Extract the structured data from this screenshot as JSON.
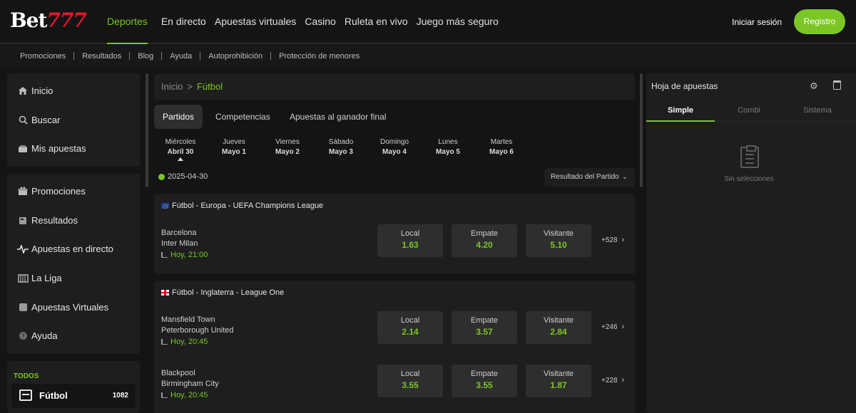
{
  "brand": {
    "logo_text": "Bet",
    "logo_num": "777",
    "accent": "#7bc624",
    "logo_red": "#e3192b"
  },
  "nav": {
    "items": [
      "Deportes",
      "En directo",
      "Apuestas virtuales",
      "Casino",
      "Ruleta en vivo",
      "Juego más seguro"
    ],
    "login": "Iniciar sesión",
    "register": "Registro"
  },
  "subnav": [
    "Promociones",
    "Resultados",
    "Blog",
    "Ayuda",
    "Autoprohibición",
    "Protección de menores"
  ],
  "sidebar": {
    "top": [
      {
        "label": "Inicio",
        "icon": "home-icon"
      },
      {
        "label": "Buscar",
        "icon": "search-icon"
      },
      {
        "label": "Mis apuestas",
        "icon": "wallet-icon"
      }
    ],
    "links": [
      {
        "label": "Promociones",
        "icon": "gift-icon"
      },
      {
        "label": "Resultados",
        "icon": "results-icon"
      },
      {
        "label": "Apuestas en directo",
        "icon": "pulse-icon"
      },
      {
        "label": "La Liga",
        "icon": "league-icon"
      },
      {
        "label": "Apuestas Virtuales",
        "icon": "virtual-icon"
      },
      {
        "label": "Ayuda",
        "icon": "help-icon"
      }
    ],
    "section_title": "TODOS",
    "sport": {
      "label": "Fútbol",
      "count": "1082"
    }
  },
  "breadcrumb": {
    "home": "Inicio",
    "sep": ">",
    "current": "Fútbol"
  },
  "tabs": [
    "Partidos",
    "Competencias",
    "Apuestas al ganador final"
  ],
  "days": [
    {
      "name": "Miércoles",
      "date": "Abril 30"
    },
    {
      "name": "Jueves",
      "date": "Mayo 1"
    },
    {
      "name": "Viernes",
      "date": "Mayo 2"
    },
    {
      "name": "Sábado",
      "date": "Mayo 3"
    },
    {
      "name": "Domingo",
      "date": "Mayo 4"
    },
    {
      "name": "Lunes",
      "date": "Mayo 5"
    },
    {
      "name": "Martes",
      "date": "Mayo 6"
    }
  ],
  "date_label": "2025-04-30",
  "market_select": "Resultado del Partido",
  "leagues": [
    {
      "title": "Fútbol - Europa - UEFA Champions League",
      "matches": [
        {
          "home": "Barcelona",
          "away": "Inter Milan",
          "time": "Hoy, 21:00",
          "odds": [
            {
              "label": "Local",
              "value": "1.63"
            },
            {
              "label": "Empate",
              "value": "4.20"
            },
            {
              "label": "Visitante",
              "value": "5.10"
            }
          ],
          "more": "+528"
        }
      ]
    },
    {
      "title": "Fútbol - Inglaterra - League One",
      "matches": [
        {
          "home": "Mansfield Town",
          "away": "Peterborough United",
          "time": "Hoy, 20:45",
          "odds": [
            {
              "label": "Local",
              "value": "2.14"
            },
            {
              "label": "Empate",
              "value": "3.57"
            },
            {
              "label": "Visitante",
              "value": "2.84"
            }
          ],
          "more": "+246"
        },
        {
          "home": "Blackpool",
          "away": "Birmingham City",
          "time": "Hoy, 20:45",
          "odds": [
            {
              "label": "Local",
              "value": "3.55"
            },
            {
              "label": "Empate",
              "value": "3.55"
            },
            {
              "label": "Visitante",
              "value": "1.87"
            }
          ],
          "more": "+228"
        }
      ]
    }
  ],
  "betslip": {
    "title": "Hoja de apuestas",
    "tabs": [
      "Simple",
      "Combi",
      "Sistema"
    ],
    "empty": "Sin selecciones"
  }
}
